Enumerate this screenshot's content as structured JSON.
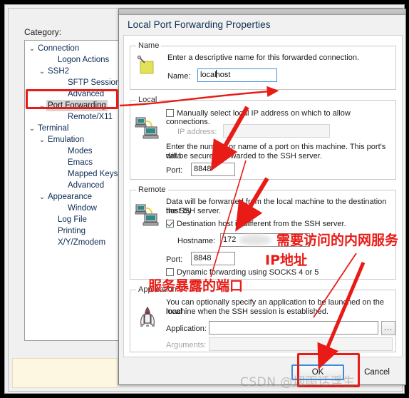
{
  "parent_window": {
    "category_label": "Category:",
    "tree": [
      {
        "label": "Connection",
        "level": 0,
        "twisty": "⌄",
        "selected": false
      },
      {
        "label": "Logon Actions",
        "level": 2,
        "twisty": "",
        "selected": false
      },
      {
        "label": "SSH2",
        "level": 1,
        "twisty": "⌄",
        "selected": false
      },
      {
        "label": "SFTP Session",
        "level": 3,
        "twisty": "",
        "selected": false
      },
      {
        "label": "Advanced",
        "level": 3,
        "twisty": "",
        "selected": false
      },
      {
        "label": "Port Forwarding",
        "level": 1,
        "twisty": "⌄",
        "selected": true
      },
      {
        "label": "Remote/X11",
        "level": 3,
        "twisty": "",
        "selected": false
      },
      {
        "label": "Terminal",
        "level": 0,
        "twisty": "⌄",
        "selected": false
      },
      {
        "label": "Emulation",
        "level": 1,
        "twisty": "⌄",
        "selected": false
      },
      {
        "label": "Modes",
        "level": 3,
        "twisty": "",
        "selected": false
      },
      {
        "label": "Emacs",
        "level": 3,
        "twisty": "",
        "selected": false
      },
      {
        "label": "Mapped Keys",
        "level": 3,
        "twisty": "",
        "selected": false
      },
      {
        "label": "Advanced",
        "level": 3,
        "twisty": "",
        "selected": false
      },
      {
        "label": "Appearance",
        "level": 1,
        "twisty": "⌄",
        "selected": false
      },
      {
        "label": "Window",
        "level": 3,
        "twisty": "",
        "selected": false
      },
      {
        "label": "Log File",
        "level": 2,
        "twisty": "",
        "selected": false
      },
      {
        "label": "Printing",
        "level": 2,
        "twisty": "",
        "selected": false
      },
      {
        "label": "X/Y/Zmodem",
        "level": 2,
        "twisty": "",
        "selected": false
      }
    ]
  },
  "dialog": {
    "title": "Local Port Forwarding Properties",
    "name_group": {
      "title": "Name",
      "description": "Enter a descriptive name for this forwarded connection.",
      "name_label": "Name:",
      "name_value_before_caret": "local",
      "name_value_after_caret": "host",
      "name_value": "localhost",
      "icon": "sticky-note-icon"
    },
    "local_group": {
      "title": "Local",
      "manual_ip_checkbox_label": "Manually select local IP address on which to allow connections.",
      "manual_ip_checked": false,
      "ip_label": "IP address:",
      "ip_value": "",
      "ip_enabled": false,
      "port_description_line1": "Enter the number or name of a port on this machine.  This port's data",
      "port_description_line2": "will be securely forwarded to the SSH server.",
      "port_label": "Port:",
      "port_value": "8848",
      "icon": "two-computers-icon"
    },
    "remote_group": {
      "title": "Remote",
      "description_line1": "Data will be forwarded from the local machine to the destination host by",
      "description_line2": "the SSH server.",
      "destination_checkbox_label": "Destination host is different from the SSH server.",
      "destination_checked": true,
      "hostname_label": "Hostname:",
      "hostname_value": "172",
      "port_label": "Port:",
      "port_value": "8848",
      "dynamic_checkbox_label": "Dynamic forwarding using SOCKS 4 or 5",
      "dynamic_checked": false,
      "icon": "two-computers-icon"
    },
    "application_group": {
      "title": "Application",
      "description_line1": "You can optionally specify an application to be launched on the local",
      "description_line2": "machine when the SSH session is established.",
      "application_label": "Application:",
      "application_value": "",
      "browse_button_label": "...",
      "arguments_label": "Arguments:",
      "arguments_value": "",
      "arguments_enabled": false,
      "icon": "rocket-icon"
    },
    "footer": {
      "ok_label": "OK",
      "cancel_label": "Cancel"
    }
  },
  "annotations": {
    "accent_color": "#e81b16",
    "note_hostname_line1": "需要访问的内网服务",
    "note_hostname_line2": "IP地址",
    "note_port": "服务暴露的端口"
  },
  "watermark": "CSDN @烟雨话浮生"
}
